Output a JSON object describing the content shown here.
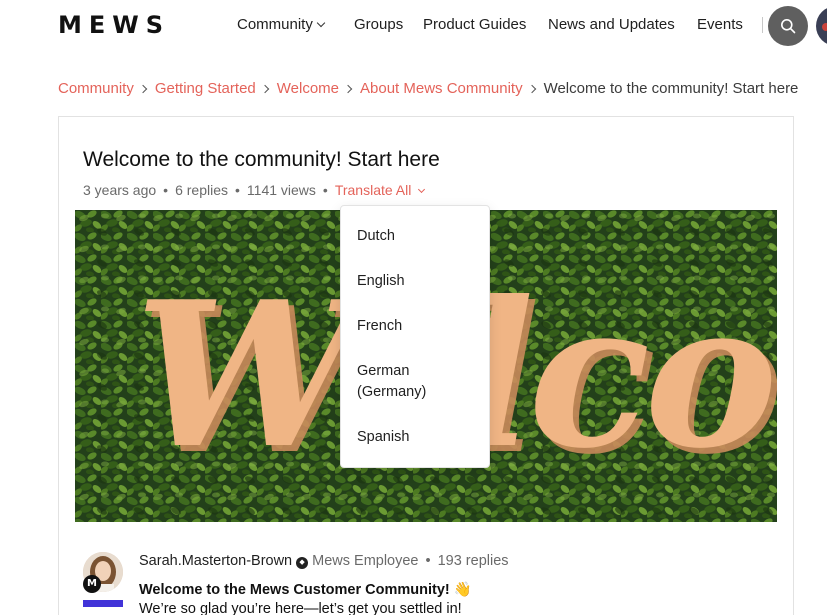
{
  "brand": {
    "logo": "MEWS"
  },
  "nav": {
    "items": [
      {
        "label": "Community",
        "has_dropdown": true
      },
      {
        "label": "Groups"
      },
      {
        "label": "Product Guides"
      },
      {
        "label": "News and Updates"
      },
      {
        "label": "Events"
      }
    ]
  },
  "breadcrumb": {
    "items": [
      "Community",
      "Getting Started",
      "Welcome",
      "About Mews Community"
    ],
    "current": "Welcome to the community! Start here"
  },
  "post": {
    "title": "Welcome to the community! Start here",
    "age": "3 years ago",
    "replies": "6 replies",
    "views": "1141 views",
    "translate_label": "Translate All",
    "hero_text": "Welcome"
  },
  "translate_menu": {
    "options": [
      "Dutch",
      "English",
      "French",
      "German (Germany)",
      "Spanish"
    ]
  },
  "author": {
    "name": "Sarah.Masterton-Brown",
    "role": "Mews Employee",
    "replies": "193 replies",
    "badge_letter": "M"
  },
  "content": {
    "heading": "Welcome to the Mews Customer Community! 👋",
    "intro": "We’re so glad you’re here—let’s get you settled in!"
  },
  "colors": {
    "accent": "#e4635a",
    "rank_bar": "#4133d8",
    "hedge_dark": "#1f3a12",
    "hedge_light": "#4d7a22",
    "letters": "#f0b585"
  }
}
